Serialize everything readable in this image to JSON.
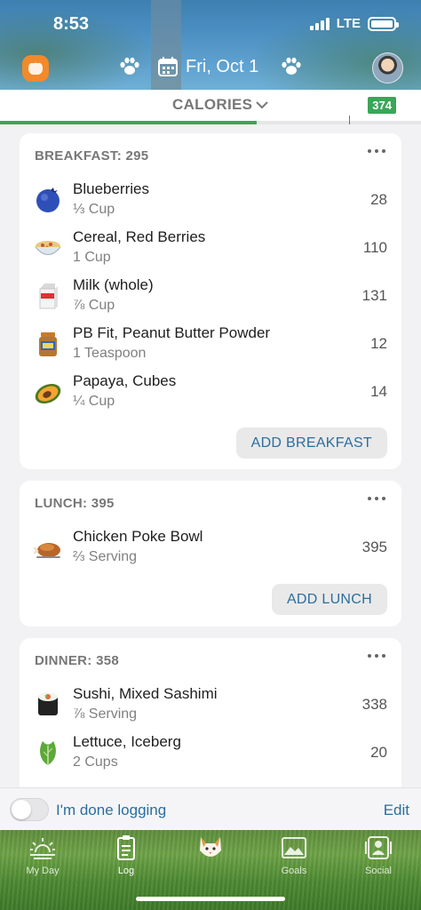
{
  "status": {
    "time": "8:53",
    "network": "LTE"
  },
  "header": {
    "date": "Fri, Oct 1"
  },
  "calories": {
    "label": "CALORIES",
    "remaining": "374",
    "progress_fraction": 0.61
  },
  "meals": [
    {
      "title": "BREAKFAST: 295",
      "add_label": "ADD BREAKFAST",
      "items": [
        {
          "name": "Blueberries",
          "qty": "⅓ Cup",
          "cal": "28",
          "icon": "blueberry-icon"
        },
        {
          "name": "Cereal, Red Berries",
          "qty": "1 Cup",
          "cal": "110",
          "icon": "cereal-bowl-icon"
        },
        {
          "name": "Milk (whole)",
          "qty": "⅞ Cup",
          "cal": "131",
          "icon": "milk-carton-icon"
        },
        {
          "name": "PB Fit, Peanut Butter Powder",
          "qty": "1 Teaspoon",
          "cal": "12",
          "icon": "peanut-butter-jar-icon"
        },
        {
          "name": "Papaya, Cubes",
          "qty": "¼ Cup",
          "cal": "14",
          "icon": "papaya-icon"
        }
      ]
    },
    {
      "title": "LUNCH: 395",
      "add_label": "ADD LUNCH",
      "items": [
        {
          "name": "Chicken Poke Bowl",
          "qty": "⅔ Serving",
          "cal": "395",
          "icon": "roast-chicken-icon"
        }
      ]
    },
    {
      "title": "DINNER: 358",
      "items": [
        {
          "name": "Sushi, Mixed Sashimi",
          "qty": "⅞ Serving",
          "cal": "338",
          "icon": "sushi-roll-icon"
        },
        {
          "name": "Lettuce, Iceberg",
          "qty": "2 Cups",
          "cal": "20",
          "icon": "lettuce-icon"
        }
      ]
    }
  ],
  "done": {
    "label": "I'm done logging",
    "edit": "Edit"
  },
  "tabs": [
    {
      "label": "My Day",
      "icon": "sunrise-icon"
    },
    {
      "label": "Log",
      "icon": "clipboard-icon"
    },
    {
      "label": "",
      "icon": "cat-mascot-icon"
    },
    {
      "label": "Goals",
      "icon": "goals-picture-icon"
    },
    {
      "label": "Social",
      "icon": "social-people-icon"
    }
  ]
}
